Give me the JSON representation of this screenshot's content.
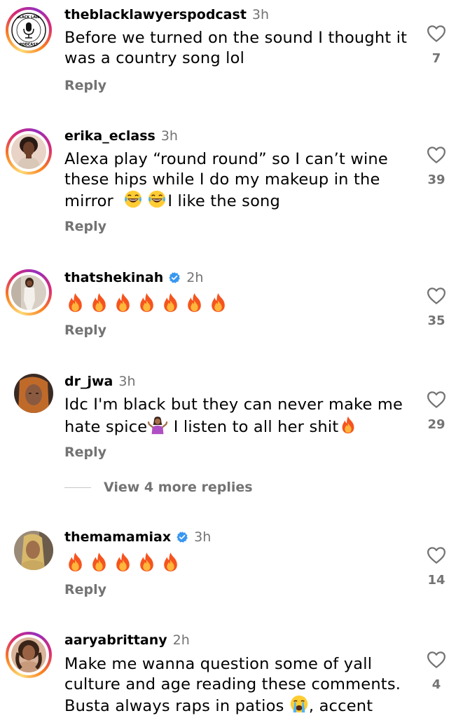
{
  "reply_label": "Reply",
  "view_more_label": "View 4 more replies",
  "colors": {
    "verified": "#3897f0",
    "meta": "#737373"
  },
  "comments": [
    {
      "username": "theblacklawyerspodcast",
      "time": "3h",
      "verified": false,
      "text_lines": [
        "Before we turned on the sound I thought it",
        "was a country song lol"
      ],
      "likes": "7",
      "avatar_icon": "podcast-logo-icon"
    },
    {
      "username": "erika_eclass",
      "time": "3h",
      "verified": false,
      "text_lines": [
        "Alexa play “round round” so I can’t wine",
        "these hips while I do my makeup in the",
        "mirror",
        "I like the song"
      ],
      "likes": "39",
      "avatar_icon": "profile-photo-icon"
    },
    {
      "username": "thatshekinah",
      "time": "2h",
      "verified": true,
      "fire_count": 7,
      "likes": "35",
      "avatar_icon": "profile-photo-icon"
    },
    {
      "username": "dr_jwa",
      "time": "3h",
      "verified": false,
      "text_lines": [
        "Idc I'm black but they can never make me",
        "hate spice",
        "I listen to all her shit"
      ],
      "likes": "29",
      "avatar_icon": "profile-photo-icon"
    },
    {
      "username": "themamamiax",
      "time": "3h",
      "verified": true,
      "fire_count": 5,
      "likes": "14",
      "avatar_icon": "profile-photo-icon"
    },
    {
      "username": "aaryabrittany",
      "time": "2h",
      "verified": false,
      "text_lines": [
        "Make me wanna question some of yall",
        "culture and age reading these comments.",
        "Busta always raps in patios",
        ", accent"
      ],
      "likes": "4",
      "avatar_icon": "profile-photo-icon"
    }
  ]
}
